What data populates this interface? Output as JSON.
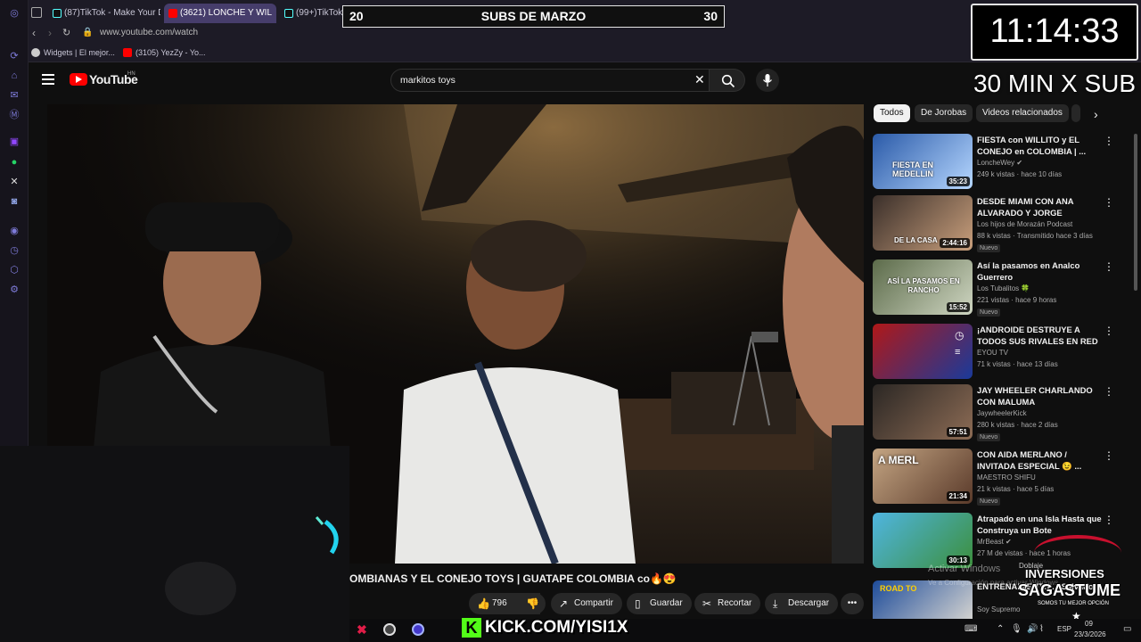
{
  "browser": {
    "tabs": [
      {
        "label": "(87)TikTok - Make Your Da",
        "icon": "tiktok-icon"
      },
      {
        "label": "(3621) LONCHE Y WIL",
        "icon": "youtube-icon"
      },
      {
        "label": "(99+)TikTok -",
        "icon": "tiktok-icon"
      }
    ],
    "url": "www.youtube.com/watch",
    "bookmarks": [
      {
        "label": "Widgets | El mejor...",
        "icon": "widget-icon"
      },
      {
        "label": "(3105) YezZy - Yo...",
        "icon": "youtube-icon"
      }
    ]
  },
  "youtube": {
    "logo": "YouTube",
    "region": "HN",
    "search_value": "markitos toys",
    "video_title": "OMBIANAS Y EL CONEJO TOYS | GUATAPE COLOMBIA co🔥😍",
    "actions": {
      "likes": "796",
      "share": "Compartir",
      "save": "Guardar",
      "clip": "Recortar",
      "download": "Descargar"
    },
    "chips": [
      "Todos",
      "De Jorobas",
      "Videos relacionados"
    ],
    "recommendations": [
      {
        "title": "FIESTA con WILLITO y EL CONEJO en COLOMBIA | ...",
        "channel": "LoncheWey",
        "verified": true,
        "meta": "249 k vistas · hace 10 días",
        "duration": "35:23",
        "new": false,
        "thumb_text": "FIESTA EN MEDELLIN"
      },
      {
        "title": "DESDE MIAMI CON ANA ALVARADO Y JORGE CORDERO",
        "channel": "Los hijos de Morazán Podcast",
        "verified": false,
        "meta": "88 k vistas · Transmitido hace 3 días",
        "duration": "2:44:16",
        "new": true,
        "thumb_text": "DE LA CASA"
      },
      {
        "title": "Así la pasamos en Analco Guerrero",
        "channel": "Los Tubalitos 🍀",
        "verified": false,
        "meta": "221 vistas · hace 9 horas",
        "duration": "15:52",
        "new": true,
        "thumb_text": "ASÍ LA PASAMOS EN RANCHO"
      },
      {
        "title": "¡ANDROIDE DESTRUYE A TODOS SUS RIVALES EN RED BULL ...",
        "channel": "EYOU TV",
        "verified": false,
        "meta": "71 k vistas · hace 13 días",
        "duration": "",
        "new": false,
        "thumb_text": ""
      },
      {
        "title": "JAY WHEELER CHARLANDO CON MALUMA",
        "channel": "JaywheelerKick",
        "verified": false,
        "meta": "280 k vistas · hace 2 días",
        "duration": "57:51",
        "new": true,
        "thumb_text": ""
      },
      {
        "title": "CON AIDA MERLANO / INVITADA ESPECIAL 😉 ...",
        "channel": "MAESTRO SHIFU",
        "verified": false,
        "meta": "21 k vistas · hace 5 días",
        "duration": "21:34",
        "new": true,
        "thumb_text": "A MERL"
      },
      {
        "title": "Atrapado en una Isla Hasta que Construya un Bote",
        "channel": "MrBeast",
        "verified": true,
        "meta": "27 M de vistas · hace 1 horas",
        "duration": "30:13",
        "new": false,
        "thumb_text": ""
      },
      {
        "title": "ENTRENAMIENTO ... Salvador",
        "channel": "Soy Supremo",
        "verified": false,
        "meta": "",
        "duration": "",
        "new": false,
        "thumb_text": "ROAD TO"
      }
    ]
  },
  "overlays": {
    "subs_left": "20",
    "subs_title": "SUBS DE MARZO",
    "subs_right": "30",
    "clock": "11:14:33",
    "subs_rule": "30 MIN X SUB",
    "kick": "KICK.COM/YISI1X",
    "sponsor_line1": "INVERSIONES",
    "sponsor_line2": "SAGASTUME",
    "sponsor_line3": "SOMOS TU MEJOR OPCIÓN",
    "watermark1": "Activar Windows",
    "watermark2": "Ve a Configuración para activar Windows.",
    "doblaje": "Doblaje"
  },
  "taskbar": {
    "lang": "ESP",
    "date": "23/3/2026",
    "time": "09"
  },
  "colors": {
    "youtube_red": "#ff0000",
    "kick_green": "#53fc18",
    "chip_active": "#f1f1f1",
    "rail_accent": "#7e7bd9"
  }
}
